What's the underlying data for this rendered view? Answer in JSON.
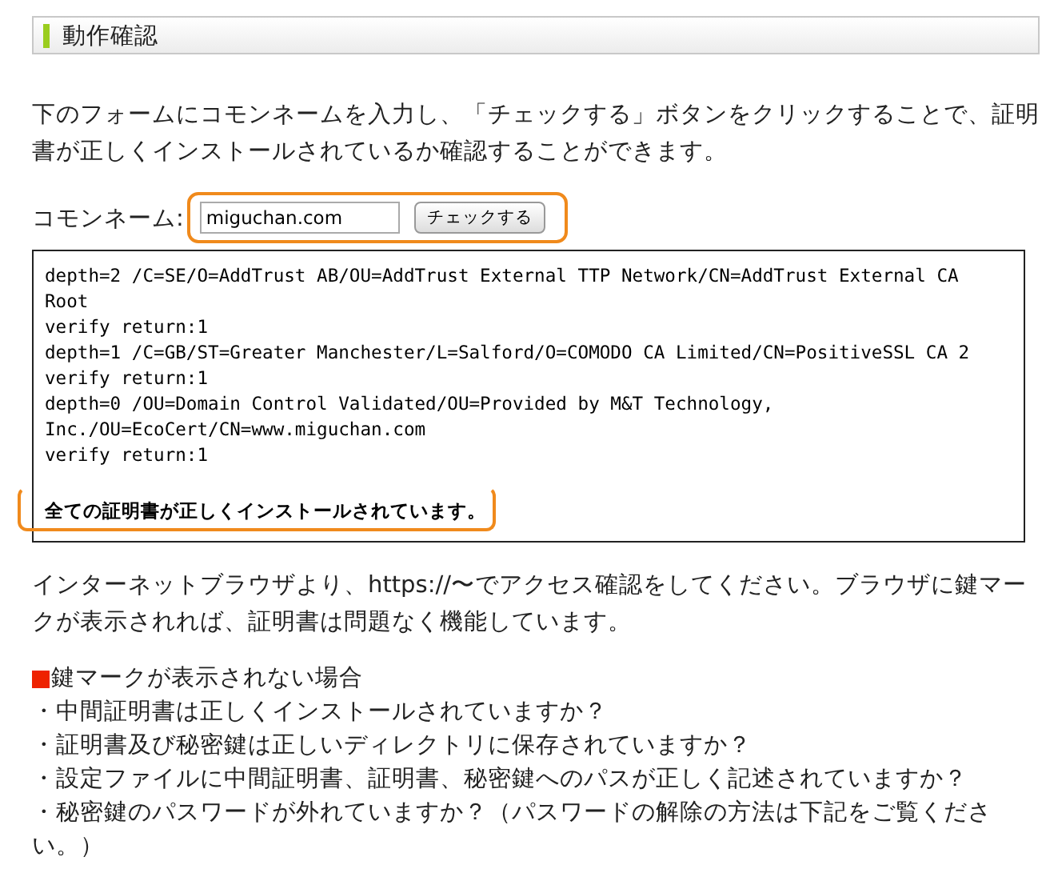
{
  "heading": "動作確認",
  "intro": "下のフォームにコモンネームを入力し、「チェックする」ボタンをクリックすることで、証明書が正しくインストールされているか確認することができます。",
  "form": {
    "label": "コモンネーム:",
    "value": "miguchan.com",
    "button": "チェックする"
  },
  "output": {
    "lines": [
      "depth=2 /C=SE/O=AddTrust AB/OU=AddTrust External TTP Network/CN=AddTrust External CA",
      "Root",
      "verify return:1",
      "depth=1 /C=GB/ST=Greater Manchester/L=Salford/O=COMODO CA Limited/CN=PositiveSSL CA 2",
      "verify return:1",
      "depth=0 /OU=Domain Control Validated/OU=Provided by M&T Technology,",
      "Inc./OU=EcoCert/CN=www.miguchan.com",
      "verify return:1"
    ],
    "result": "全ての証明書が正しくインストールされています。"
  },
  "note": "インターネットブラウザより、https://〜でアクセス確認をしてください。ブラウザに鍵マークが表示されれば、証明書は問題なく機能しています。",
  "troubleshooting": {
    "title": "鍵マークが表示されない場合",
    "items": [
      "・中間証明書は正しくインストールされていますか？",
      "・証明書及び秘密鍵は正しいディレクトリに保存されていますか？",
      "・設定ファイルに中間証明書、証明書、秘密鍵へのパスが正しく記述されていますか？",
      "・秘密鍵のパスワードが外れていますか？（パスワードの解除の方法は下記をご覧ください。）"
    ]
  }
}
